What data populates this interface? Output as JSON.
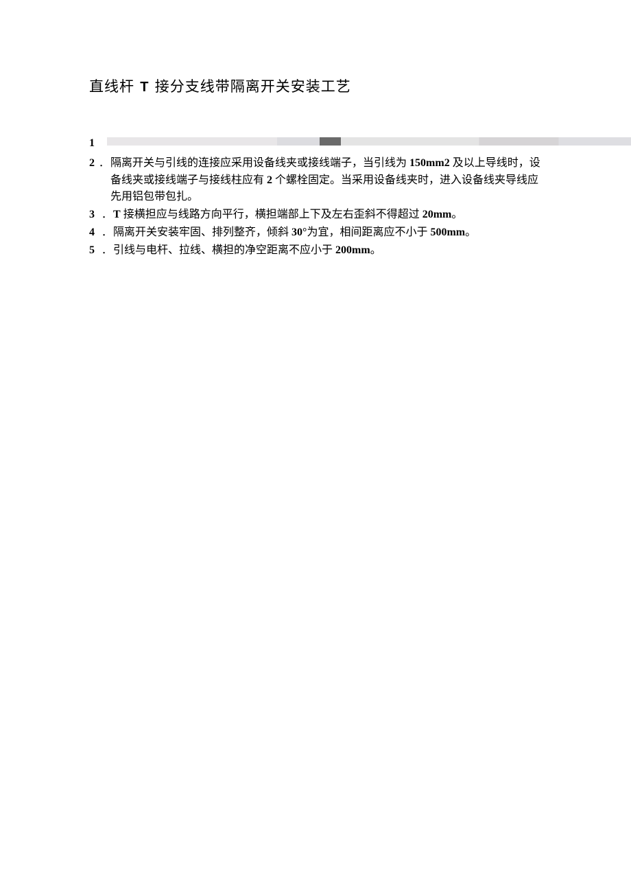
{
  "title": {
    "prefix": "直线杆 ",
    "t": "T",
    "suffix": " 接分支线带隔离开关安装工艺"
  },
  "items": [
    {
      "num": "1",
      "period": "",
      "segments": []
    },
    {
      "num": "2",
      "period": "．",
      "segments": [
        {
          "t": "隔离开关与引线的连接应采用设备线夹或接线端子，当引线为 ",
          "b": false
        },
        {
          "t": "150mm2",
          "b": true
        },
        {
          "t": " 及以上导线时，设备线夹或接线端子与接线柱应有 ",
          "b": false
        },
        {
          "t": "2",
          "b": true
        },
        {
          "t": " 个螺栓固定。当采用设备线夹时，进入设备线夹导线应先用铝包带包扎。",
          "b": false
        }
      ]
    },
    {
      "num": "3",
      "period": "．",
      "segments": [
        {
          "t": "T",
          "b": true
        },
        {
          "t": " 接横担应与线路方向平行，横担端部上下及左右歪斜不得超过 ",
          "b": false
        },
        {
          "t": "20mm",
          "b": true
        },
        {
          "t": "。",
          "b": false
        }
      ]
    },
    {
      "num": "4",
      "period": "．",
      "segments": [
        {
          "t": "隔离开关安装牢固、排列整齐，倾斜 ",
          "b": false
        },
        {
          "t": "30°",
          "b": true
        },
        {
          "t": "为宜，相间距离应不小于 ",
          "b": false
        },
        {
          "t": "500mm",
          "b": true
        },
        {
          "t": "。",
          "b": false
        }
      ]
    },
    {
      "num": "5",
      "period": "．",
      "segments": [
        {
          "t": "引线与电杆、拉线、横担的净空距离不应小于 ",
          "b": false
        },
        {
          "t": "200mm",
          "b": true
        },
        {
          "t": "。",
          "b": false
        }
      ]
    }
  ]
}
